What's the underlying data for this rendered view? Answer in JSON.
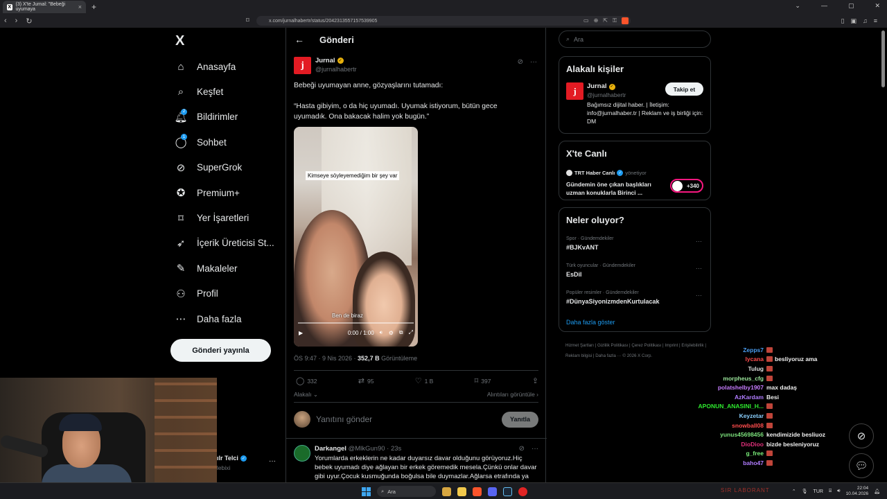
{
  "browser": {
    "tab_title": "(3) X'te Jurnal: \"Bebeği uyumaya",
    "new_tab": "+",
    "url": "x.com/jurnalhabertr/status/2042313557157539905"
  },
  "nav": {
    "logo": "X",
    "items": [
      {
        "label": "Anasayfa",
        "icon": "home-icon",
        "glyph": "⌂"
      },
      {
        "label": "Keşfet",
        "icon": "search-icon",
        "glyph": "⌕"
      },
      {
        "label": "Bildirimler",
        "icon": "bell-icon",
        "glyph": "🔔︎",
        "badge": "2"
      },
      {
        "label": "Sohbet",
        "icon": "chat-icon",
        "glyph": "◯",
        "badge": "1"
      },
      {
        "label": "SuperGrok",
        "icon": "grok-icon",
        "glyph": "⊘"
      },
      {
        "label": "Premium+",
        "icon": "premium-icon",
        "glyph": "✪"
      },
      {
        "label": "Yer İşaretleri",
        "icon": "bookmark-icon",
        "glyph": "⌑"
      },
      {
        "label": "İçerik Üreticisi St...",
        "icon": "rocket-icon",
        "glyph": "➶"
      },
      {
        "label": "Makaleler",
        "icon": "article-icon",
        "glyph": "✎"
      },
      {
        "label": "Profil",
        "icon": "profile-icon",
        "glyph": "⚇"
      },
      {
        "label": "Daha fazla",
        "icon": "more-circle-icon",
        "glyph": "⋯"
      }
    ],
    "post_button": "Gönderi yayınla"
  },
  "main": {
    "title": "Gönderi",
    "tweet": {
      "name": "Jurnal",
      "handle": "@jurnalhabertr",
      "text1": "Bebeği uyumayan anne, gözyaşlarını tutamadı:",
      "text2": "“Hasta gibiyim, o da hiç uyumadı. Uyumak istiyorum, bütün gece uyumadık. Ona bakacak halim yok bugün.”",
      "video_caption_top": "Kimseye söyleyemediğim bir şey var",
      "video_caption_bottom": "Ben de biraz",
      "video_time": "0:00 / 1:00",
      "timestamp": "ÖS 9:47 · 9 Nis 2026 · ",
      "views": "352,7 B",
      "views_label": " Görüntüleme",
      "replies": "332",
      "reposts": "95",
      "likes": "1 B",
      "bookmarks": "397",
      "related": "Alakalı",
      "quotes": "Alıntıları görüntüle"
    },
    "reply": {
      "placeholder": "Yanıtını gönder",
      "button": "Yanıtla"
    },
    "comment": {
      "name": "Darkangel",
      "handle": "@MlkGun90 · 23s",
      "text": "Yorumlarda erkeklerin ne kadar duyarsız davar olduğunu görüyoruz.Hiç bebek uyumadı diye ağlayan bir erkek göremedik mesela.Çünkü onlar davar gibi uyur.Çocuk kusmuğunda boğulsa bile duymazlar.Ağlarsa etrafında ya"
    }
  },
  "right": {
    "search_placeholder": "Ara",
    "related_people": {
      "title": "Alakalı kişiler",
      "name": "Jurnal",
      "handle": "@jurnalhabertr",
      "bio": "Bağımsız dijital haber. | İletişim: info@jurnalhaber.tr | Reklam ve iş birliği için: DM",
      "follow": "Takip et"
    },
    "live": {
      "title": "X'te Canlı",
      "account": "TRT Haber Canlı",
      "role": "yönetiyor",
      "text": "Gündemin öne çıkan başlıkları uzman konuklarla Birinci ...",
      "count": "+340"
    },
    "trends": {
      "title": "Neler oluyor?",
      "items": [
        {
          "category": "Spor · Gündemdekiler",
          "name": "#BJKvANT"
        },
        {
          "category": "Türk oyuncular · Gündemdekiler",
          "name": "EsDil"
        },
        {
          "category": "Popüler resimler · Gündemdekiler",
          "name": "#DünyaSiyonizmdenKurtulacak"
        }
      ],
      "show_more": "Daha fazla göster"
    },
    "footer": "Hizmet Şartları  |  Gizlilik Politikası  |  Çerez Politikası  |  Imprint  |  Erişilebilirlik  |  Reklam bilgisi  |  Daha fazla ···  © 2026 X Corp."
  },
  "chat": [
    {
      "user": "Zepps7",
      "color": "#4a9df0",
      "msg": "",
      "emote": true
    },
    {
      "user": "lycana",
      "color": "#ff4d4d",
      "msg": "besliyoruz ama",
      "emote": true
    },
    {
      "user": "Tulug",
      "color": "#e0e0e0",
      "msg": "",
      "emote": true
    },
    {
      "user": "morpheus_cfg",
      "color": "#9be59b",
      "msg": "",
      "emote": true
    },
    {
      "user": "polatshelby1907",
      "color": "#c77dff",
      "msg": "max dadaş",
      "emote": false
    },
    {
      "user": "AzKardam",
      "color": "#b07cff",
      "msg": "Besi",
      "emote": false
    },
    {
      "user": "APONUN_ANASINI_H...",
      "color": "#2ee82e",
      "msg": "",
      "emote": true
    },
    {
      "user": "Keyzetar",
      "color": "#8ad0ff",
      "msg": "",
      "emote": true
    },
    {
      "user": "snowball08",
      "color": "#ff4d4d",
      "msg": "",
      "emote": true
    },
    {
      "user": "yunus45698456",
      "color": "#7be07b",
      "msg": "kendimizide besliuoz",
      "emote": false
    },
    {
      "user": "DioDioo",
      "color": "#e0307a",
      "msg": "bizde besleniyoruz",
      "emote": false
    },
    {
      "user": "g_free",
      "color": "#7bf07b",
      "msg": "",
      "emote": true
    },
    {
      "user": "baho47",
      "color": "#b07cff",
      "msg": "",
      "emote": true
    }
  ],
  "side_account": {
    "name": "ılr Telci",
    "handle": "lebixi"
  },
  "taskbar": {
    "search": "Ara",
    "lang": "TUR",
    "time": "22:04",
    "date": "10.04.2026"
  }
}
